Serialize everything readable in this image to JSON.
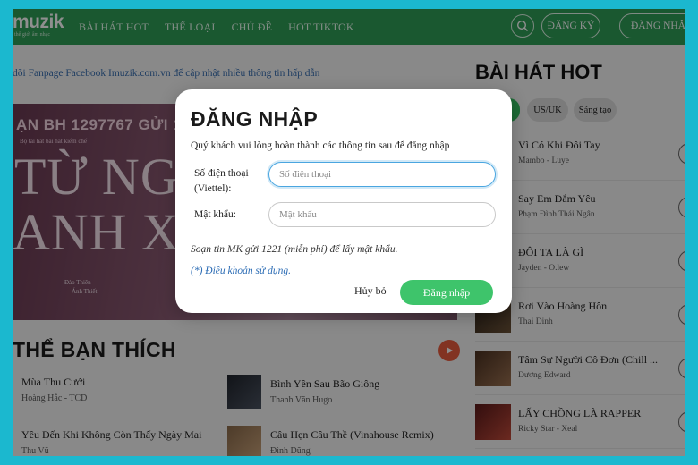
{
  "header": {
    "logo_text": "muzik",
    "logo_sub": "thế giới âm nhạc",
    "nav": [
      "BÀI HÁT HOT",
      "THỂ LOẠI",
      "CHỦ ĐỀ",
      "HOT TIKTOK"
    ],
    "register_label": "ĐĂNG KÝ",
    "login_label": "ĐĂNG NHẬ"
  },
  "main": {
    "notice": "dõi Fanpage Facebook Imuzik.com.vn để cập nhật nhiều thông tin hấp dẫn",
    "banner": {
      "top_text": "ẠN BH 1297767 GỬI 1221",
      "small_text": "Bộ tải hát bài hát kiểm chế",
      "big_line1": "TỪ NGÀY",
      "big_line2": "ANH XA",
      "signature1": "Đào Thiên",
      "signature2": "Ánh Thiết"
    },
    "section_title": "THỂ BẠN THÍCH",
    "songs_left": [
      {
        "title": "Mùa Thu Cưới",
        "artist": "Hoàng Hắc - TCD"
      },
      {
        "title": "Yêu Đến Khi Không Còn Thấy Ngày Mai",
        "artist": "Thu Vũ"
      }
    ],
    "songs_mid": [
      {
        "title": "Bình Yên Sau Bão Giông",
        "artist": "Thanh Văn Hugo"
      },
      {
        "title": "Câu Hẹn Câu Thề (Vinahouse Remix)",
        "artist": "Đình Dũng"
      }
    ]
  },
  "right": {
    "title": "BÀI HÁT HOT",
    "chips": [
      "US/UK",
      "Sáng tạo"
    ],
    "hot_songs": [
      {
        "title": "Vì Có Khi Đôi Tay",
        "artist": "Mambo - Luye"
      },
      {
        "title": "Say Em Đắm Yêu",
        "artist": "Phạm Đình Thái Ngân"
      },
      {
        "title": "ĐÔI TA LÀ GÌ",
        "artist": "Jayden - O.lew"
      },
      {
        "title": "Rơi Vào Hoàng Hôn",
        "artist": "Thai Dinh"
      },
      {
        "title": "Tâm Sự Người Cô Đơn (Chill ...",
        "artist": "Dương Edward"
      },
      {
        "title": "LẤY CHỒNG LÀ RAPPER",
        "artist": "Ricky Star - Xeal"
      }
    ]
  },
  "modal": {
    "title": "ĐĂNG NHẬP",
    "description": "Quý khách vui lòng hoàn thành các thông tin sau để đăng nhập",
    "phone_label": "Số điện thoại (Viettel):",
    "phone_placeholder": "Số điện thoại",
    "password_label": "Mật khẩu:",
    "password_placeholder": "Mật khẩu",
    "sms_note": "Soạn tin MK gửi 1221 (miễn phí) để lấy mật khẩu.",
    "terms_link": "(*) Điều khoản sử dụng.",
    "cancel_label": "Hủy bỏ",
    "submit_label": "Đăng nhập"
  },
  "colors": {
    "header_green": "#2f9d57",
    "primary_button": "#3ec46b",
    "link_blue": "#2a6bb4",
    "frame_cyan": "#1bb8cf"
  }
}
